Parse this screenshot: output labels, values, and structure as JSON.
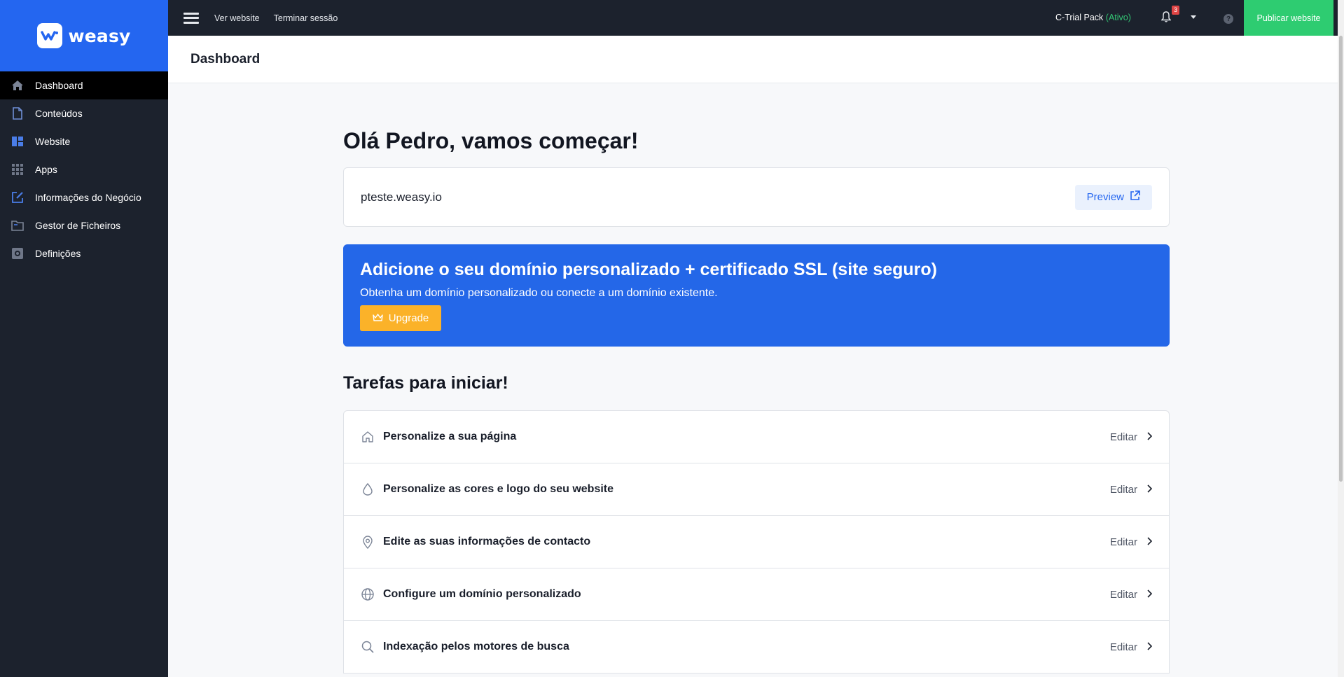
{
  "app": {
    "brand_name": "weasy",
    "accent_color": "#2466f0",
    "success_color": "#2ecc71",
    "warning_color": "#fbb229"
  },
  "sidebar": {
    "items": [
      {
        "label": "Dashboard",
        "icon": "home-icon",
        "active": true
      },
      {
        "label": "Conteúdos",
        "icon": "document-icon",
        "active": false
      },
      {
        "label": "Website",
        "icon": "layout-icon",
        "active": false
      },
      {
        "label": "Apps",
        "icon": "grid-icon",
        "active": false
      },
      {
        "label": "Informações do Negócio",
        "icon": "edit-icon",
        "active": false
      },
      {
        "label": "Gestor de Ficheiros",
        "icon": "folder-icon",
        "active": false
      },
      {
        "label": "Definições",
        "icon": "settings-icon",
        "active": false
      }
    ]
  },
  "topbar": {
    "links": [
      "Ver website",
      "Terminar sessão"
    ],
    "plan_name": "C-Trial Pack",
    "plan_status": "(Ativo)",
    "notification_count": "3",
    "help_symbol": "?",
    "publish_label": "Publicar website"
  },
  "page": {
    "title": "Dashboard"
  },
  "main": {
    "greeting": "Olá Pedro, vamos começar!",
    "site_url": "pteste.weasy.io",
    "preview_label": "Preview",
    "banner": {
      "title": "Adicione o seu domínio personalizado + certificado SSL (site seguro)",
      "subtitle": "Obtenha um domínio personalizado ou conecte a um domínio existente.",
      "button_label": "Upgrade"
    },
    "tasks_title": "Tarefas para iniciar!",
    "tasks": [
      {
        "label": "Personalize a sua página",
        "action": "Editar",
        "icon": "home-outline-icon"
      },
      {
        "label": "Personalize as cores e logo do seu website",
        "action": "Editar",
        "icon": "droplet-icon"
      },
      {
        "label": "Edite as suas informações de contacto",
        "action": "Editar",
        "icon": "map-pin-icon"
      },
      {
        "label": "Configure um domínio personalizado",
        "action": "Editar",
        "icon": "globe-icon"
      },
      {
        "label": "Indexação pelos motores de busca",
        "action": "Editar",
        "icon": "search-icon"
      }
    ]
  }
}
